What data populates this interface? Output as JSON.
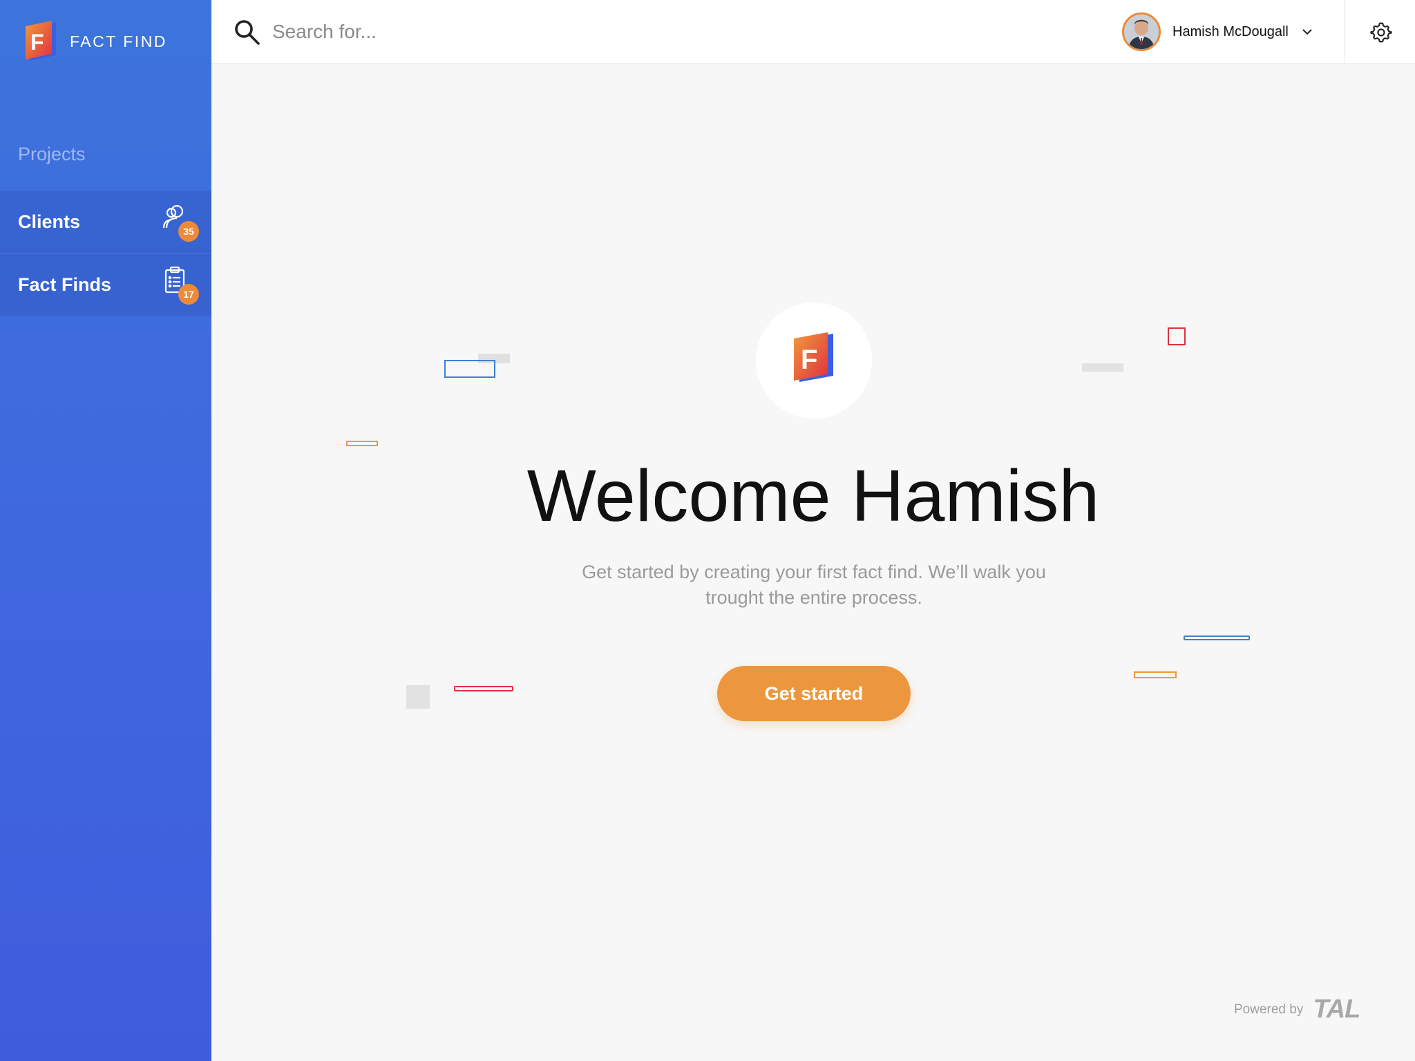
{
  "app": {
    "brand_name": "FACT FIND",
    "brand_letter": "F"
  },
  "sidebar": {
    "section_label": "Projects",
    "items": [
      {
        "label": "Clients",
        "icon": "users-icon",
        "badge": "35"
      },
      {
        "label": "Fact Finds",
        "icon": "clipboard-list-icon",
        "badge": "17"
      }
    ]
  },
  "header": {
    "search": {
      "placeholder": "Search for...",
      "value": ""
    },
    "user": {
      "name": "Hamish McDougall"
    }
  },
  "main": {
    "logo_letter": "F",
    "title": "Welcome Hamish",
    "subtitle": "Get started by creating your first fact find. We’ll walk you trought the entire process.",
    "cta_label": "Get started"
  },
  "footer": {
    "powered_by": "Powered by",
    "partner": "TAL"
  },
  "colors": {
    "sidebar_top": "#3d74dc",
    "sidebar_bottom": "#3f5cdd",
    "accent_orange": "#ec973d",
    "badge_orange": "#ec8a3a",
    "deco_blue": "#3d7fd4",
    "deco_red": "#e0303e",
    "deco_gray": "#dedede"
  }
}
